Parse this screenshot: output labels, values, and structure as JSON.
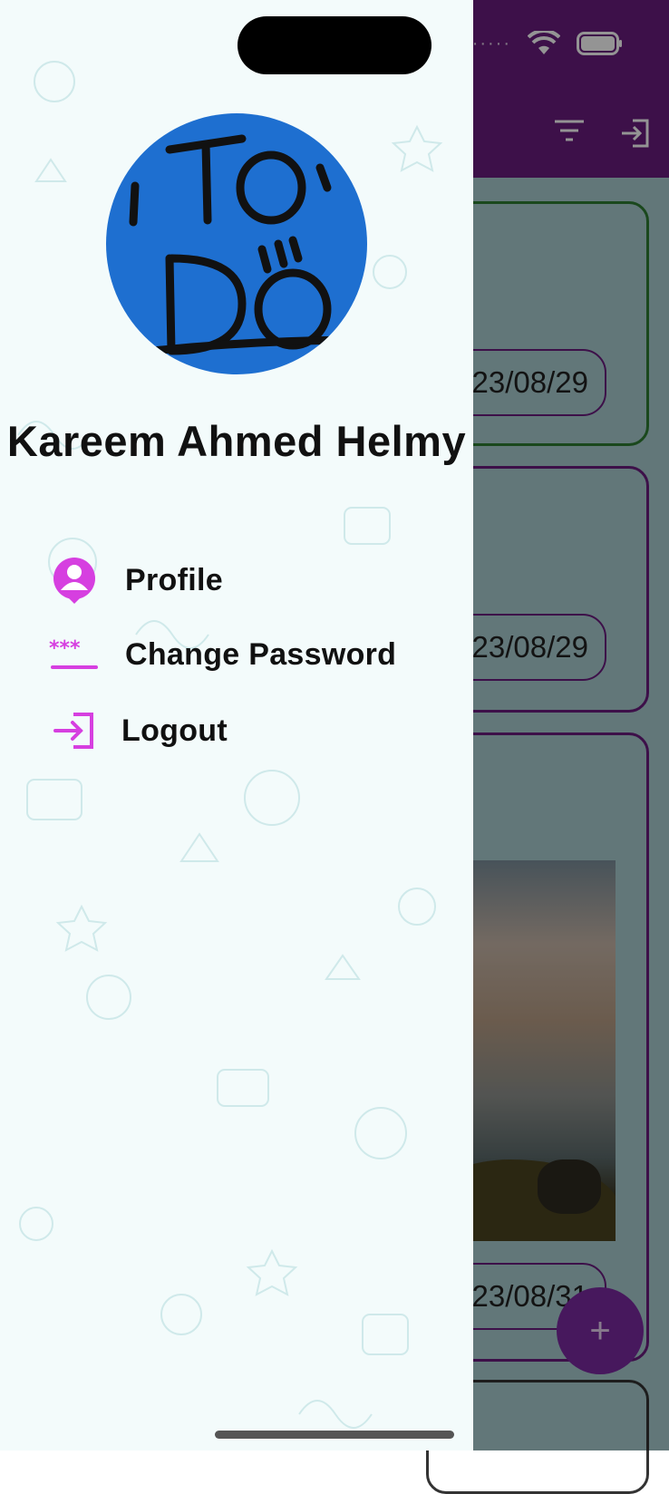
{
  "drawer": {
    "user_name": "Kareem Ahmed Helmy",
    "avatar": {
      "text_line1": "To",
      "text_line2": "Do"
    },
    "menu": [
      {
        "label": "Profile",
        "icon": "profile-icon"
      },
      {
        "label": "Change Password",
        "icon": "password-icon"
      },
      {
        "label": "Logout",
        "icon": "logout-icon"
      }
    ]
  },
  "background": {
    "cards": [
      {
        "date": "23/08/29",
        "border": "#2e7d32"
      },
      {
        "date": "23/08/29",
        "border": "#6a1c7f"
      },
      {
        "date": "23/08/31",
        "border": "#6a1c7f"
      }
    ],
    "fab_label": "+"
  },
  "colors": {
    "accent": "#d63fe0",
    "appbar": "#6a1c7f",
    "avatar_bg": "#1e6fd0"
  }
}
